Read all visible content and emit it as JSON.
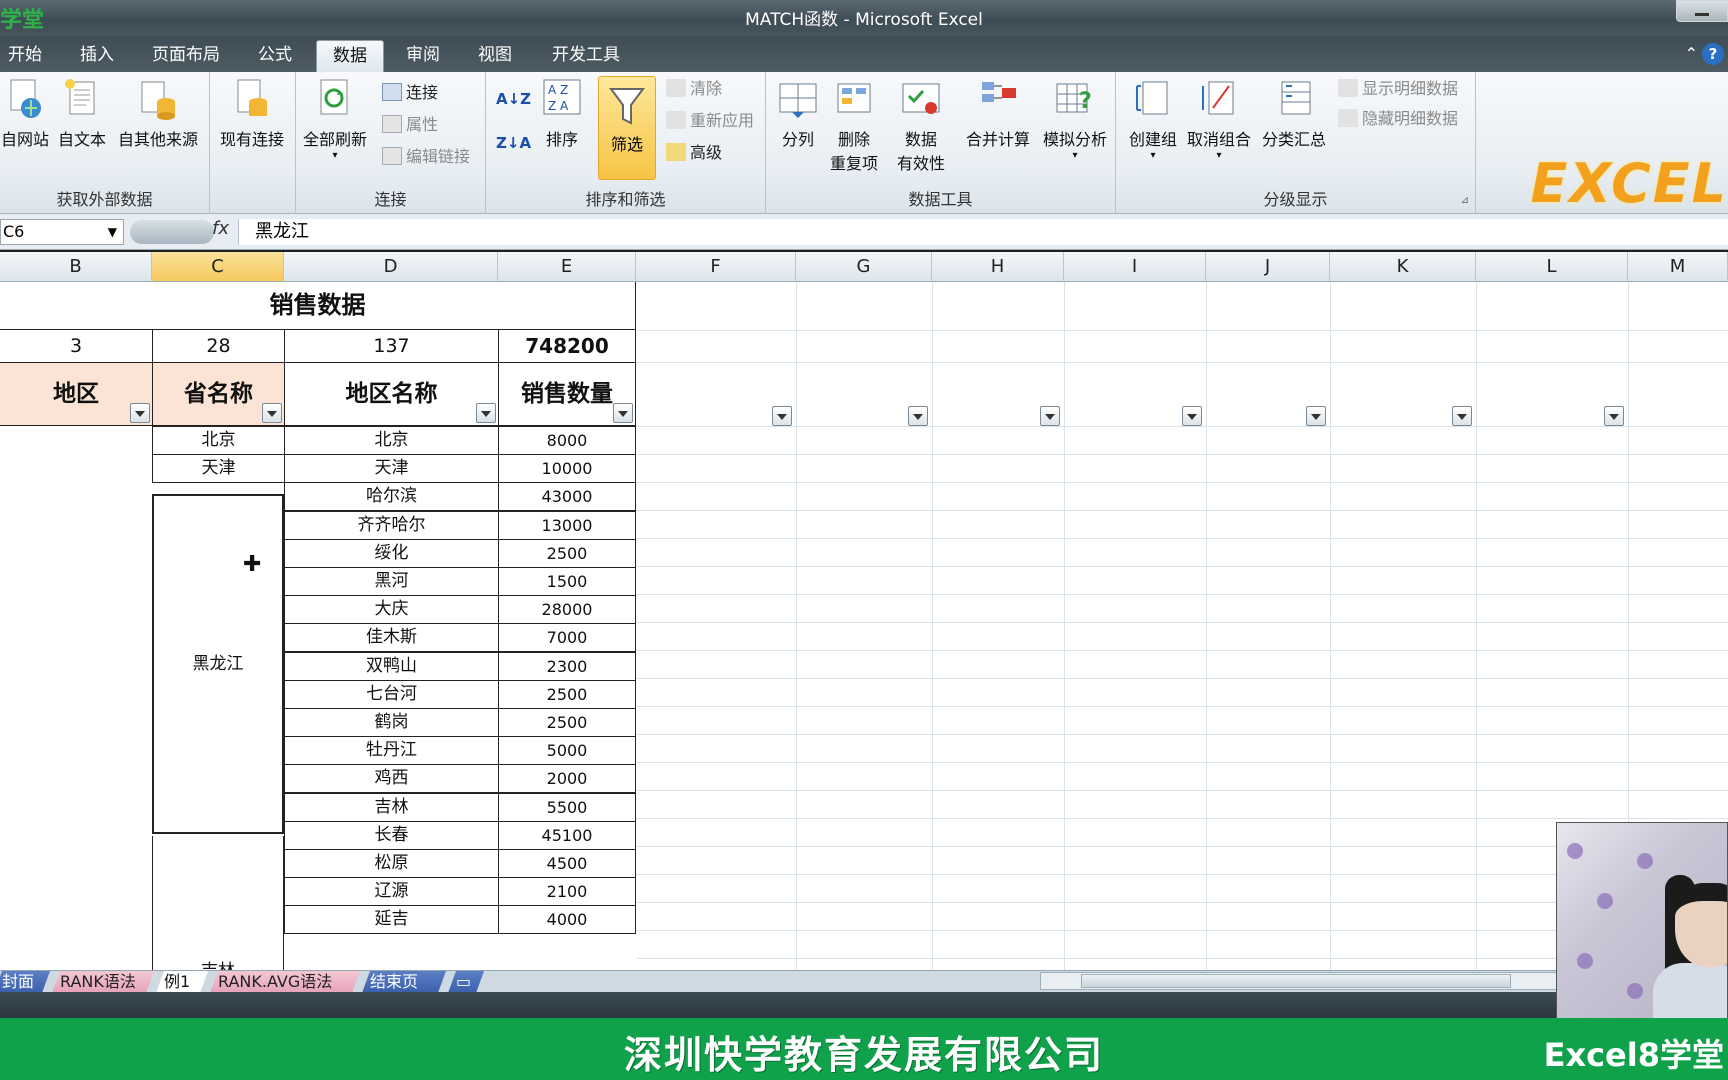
{
  "window": {
    "title": "MATCH函数 - Microsoft Excel",
    "logo": "学堂"
  },
  "tabs": [
    "开始",
    "插入",
    "页面布局",
    "公式",
    "数据",
    "审阅",
    "视图",
    "开发工具"
  ],
  "active_tab": "数据",
  "ribbon": {
    "get_external": {
      "label": "获取外部数据",
      "buttons": [
        "自网站",
        "自文本",
        "自其他来源",
        "现有连接"
      ]
    },
    "connections": {
      "label": "连接",
      "refresh_all": "全部刷新",
      "items": [
        "连接",
        "属性",
        "编辑链接"
      ]
    },
    "sort_filter": {
      "label": "排序和筛选",
      "sort": "排序",
      "filter": "筛选",
      "items": [
        "清除",
        "重新应用",
        "高级"
      ]
    },
    "data_tools": {
      "label": "数据工具",
      "buttons": [
        "分列",
        "删除",
        "重复项",
        "数据",
        "有效性",
        "合并计算",
        "模拟分析"
      ]
    },
    "outline": {
      "label": "分级显示",
      "buttons": [
        "创建组",
        "取消组合",
        "分类汇总"
      ],
      "items": [
        "显示明细数据",
        "隐藏明细数据"
      ]
    },
    "brand": "EXCEL"
  },
  "formula_bar": {
    "name_box": "C6",
    "fx": "fx",
    "content": "黑龙江"
  },
  "columns": [
    "B",
    "C",
    "D",
    "E",
    "F",
    "G",
    "H",
    "I",
    "J",
    "K",
    "L",
    "M"
  ],
  "selected_column": "C",
  "sheet": {
    "title": "销售数据",
    "counts": [
      "3",
      "28",
      "137",
      "748200"
    ],
    "headers": [
      "地区",
      "省名称",
      "地区名称",
      "销售数量"
    ],
    "rows": [
      {
        "province": "北京",
        "region": "北京",
        "qty": "8000"
      },
      {
        "province": "天津",
        "region": "天津",
        "qty": "10000"
      },
      {
        "province": "",
        "region": "哈尔滨",
        "qty": "43000"
      },
      {
        "province": "",
        "region": "齐齐哈尔",
        "qty": "13000"
      },
      {
        "province": "",
        "region": "绥化",
        "qty": "2500"
      },
      {
        "province": "",
        "region": "黑河",
        "qty": "1500"
      },
      {
        "province": "",
        "region": "大庆",
        "qty": "28000"
      },
      {
        "province": "",
        "region": "佳木斯",
        "qty": "7000"
      },
      {
        "province": "",
        "region": "双鸭山",
        "qty": "2300"
      },
      {
        "province": "",
        "region": "七台河",
        "qty": "2500"
      },
      {
        "province": "",
        "region": "鹤岗",
        "qty": "2500"
      },
      {
        "province": "",
        "region": "牡丹江",
        "qty": "5000"
      },
      {
        "province": "",
        "region": "鸡西",
        "qty": "2000"
      },
      {
        "province": "",
        "region": "吉林",
        "qty": "5500"
      },
      {
        "province": "",
        "region": "长春",
        "qty": "45100"
      },
      {
        "province": "",
        "region": "松原",
        "qty": "4500"
      },
      {
        "province": "",
        "region": "辽源",
        "qty": "2100"
      },
      {
        "province": "",
        "region": "延吉",
        "qty": "4000"
      }
    ],
    "merged_province_heilongjiang": "黑龙江",
    "merged_province_jilin": "吉林"
  },
  "sheet_tabs": [
    "封面",
    "RANK语法",
    "例1",
    "RANK.AVG语法",
    "结束页"
  ],
  "active_sheet": "例1",
  "footer": {
    "company": "深圳快学教育发展有限公司",
    "brand": "Excel8学堂"
  },
  "colors": {
    "ribbon_bg": "#e8eef3",
    "header_peach": "#fbe4d5",
    "footer_green": "#0fa24a",
    "filter_active": "#f6c445"
  }
}
